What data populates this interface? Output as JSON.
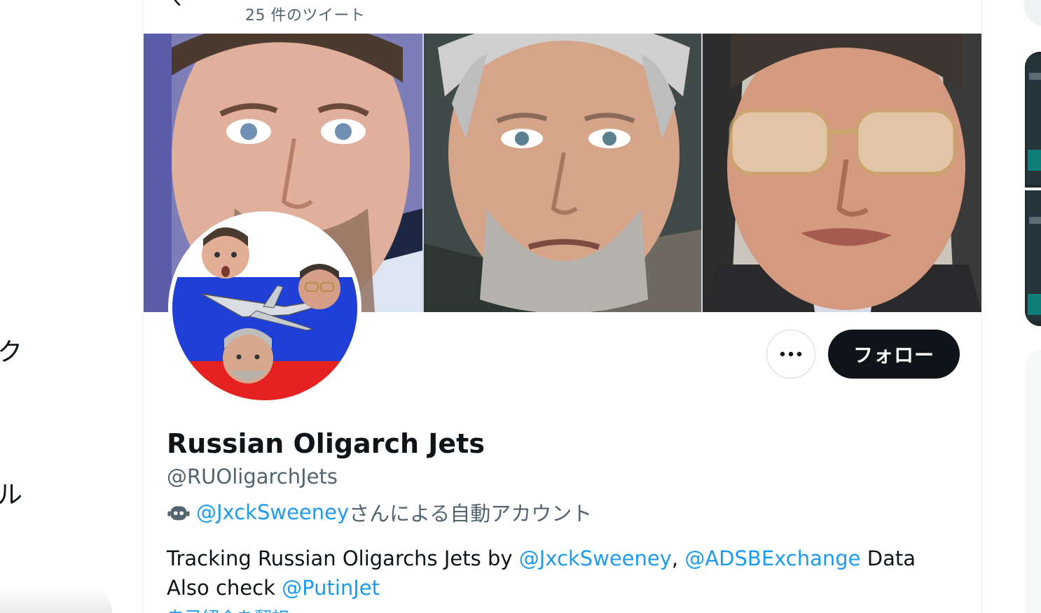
{
  "left_nav": {
    "partial_item_1": "ク",
    "partial_item_2": "ル"
  },
  "header": {
    "tweet_count_text": "25 件のツイート"
  },
  "profile": {
    "display_name": "Russian Oligarch Jets",
    "handle": "@RUOligarchJets",
    "automated_by_link": "@JxckSweeney",
    "automated_by_suffix": "さんによる自動アカウント",
    "follow_label": "フォロー",
    "more_label": "•••",
    "bio": {
      "text_1": "Tracking Russian Oligarchs Jets by ",
      "link_1": "@JxckSweeney",
      "sep": ", ",
      "link_2": "@ADSBExchange",
      "text_2": " Data Also check ",
      "link_3": "@PutinJet"
    },
    "translate_label": "自己紹介を翻訳"
  },
  "icons": {
    "back": "back-arrow-icon",
    "more": "more-dots-icon",
    "automated": "robot-icon"
  },
  "colors": {
    "accent": "#1d9bf0",
    "text_primary": "#0f1419",
    "text_secondary": "#536471",
    "follow_bg": "#0f1419",
    "flag_white": "#ffffff",
    "flag_blue": "#1f3fd6",
    "flag_red": "#e5221f"
  }
}
